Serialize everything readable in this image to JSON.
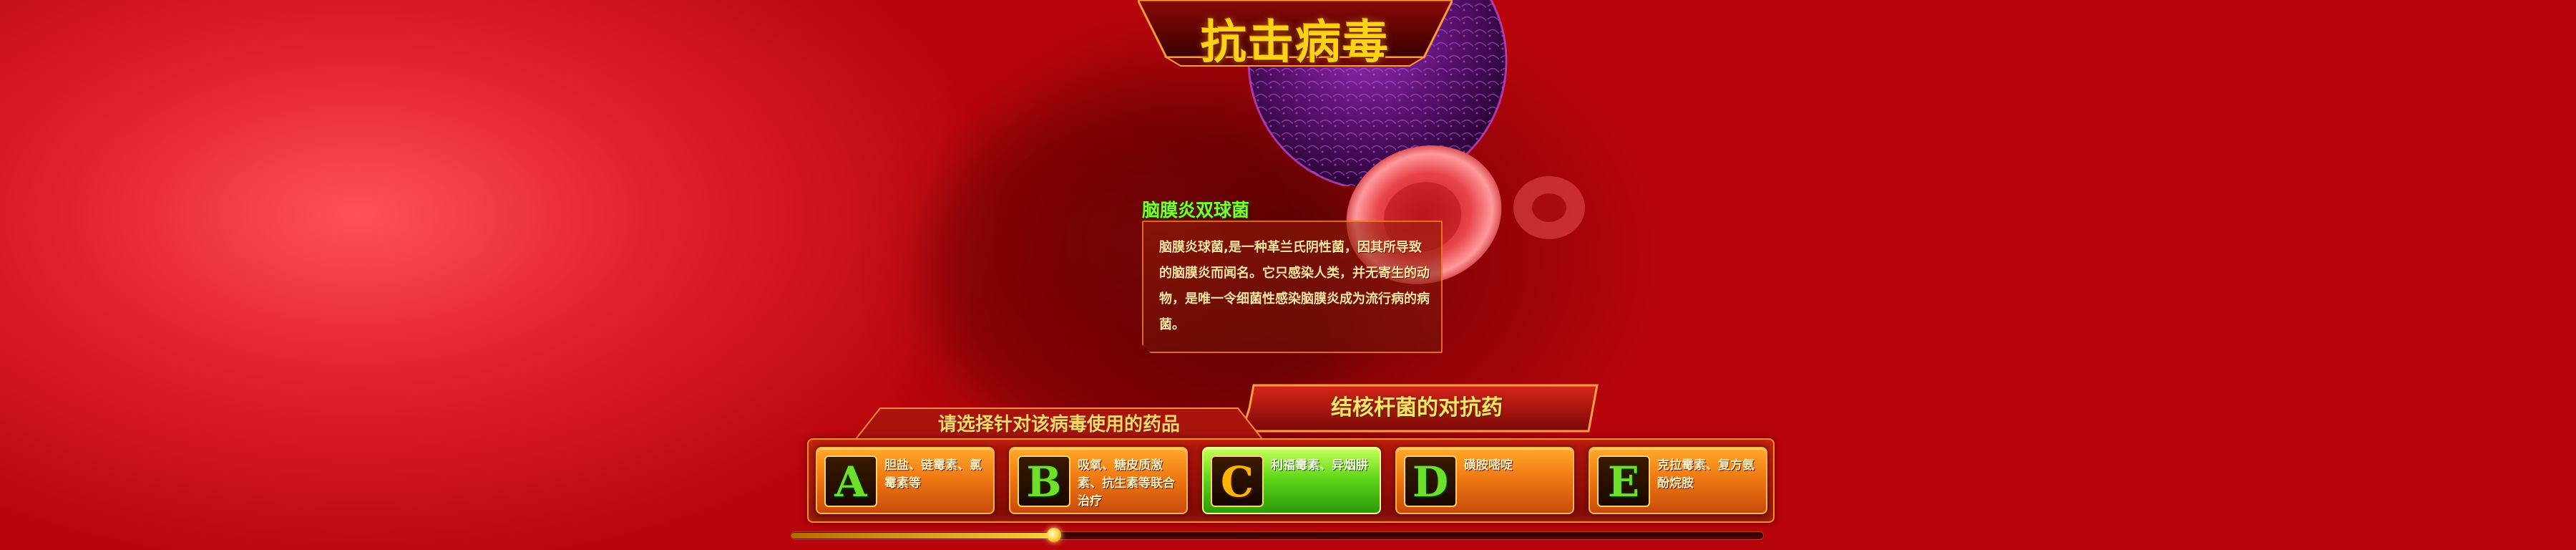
{
  "game": {
    "title": "抗击病毒",
    "virus_name": "脑膜炎双球菌",
    "description": "脑膜炎球菌,是一种革兰氏阴性菌，因其所导致的脑膜炎而闻名。它只感染人类，并无寄生的动物，是唯一令细菌性感染脑膜炎成为流行病的病菌。",
    "drug_name": "结核杆菌的对抗药",
    "prompt": "请选择针对该病毒使用的药品",
    "selected_option": "C",
    "progress": 0.27
  },
  "options": [
    {
      "letter": "A",
      "text": "胆盐、链霉素、氯霉素等"
    },
    {
      "letter": "B",
      "text": "吸氧、糖皮质激素、抗生素等联合治疗"
    },
    {
      "letter": "C",
      "text": "利福霉素、异烟肼"
    },
    {
      "letter": "D",
      "text": "磺胺嘧啶"
    },
    {
      "letter": "E",
      "text": "克拉霉素、复方氨酚烷胺"
    }
  ],
  "colors": {
    "background": "#d4161d",
    "title": "#ffd21a",
    "virus_name": "#7cff2c",
    "option_normal": "#f07a14",
    "option_selected": "#62d81a",
    "letter_normal": "#6ee02a",
    "letter_selected": "#ffb400"
  }
}
